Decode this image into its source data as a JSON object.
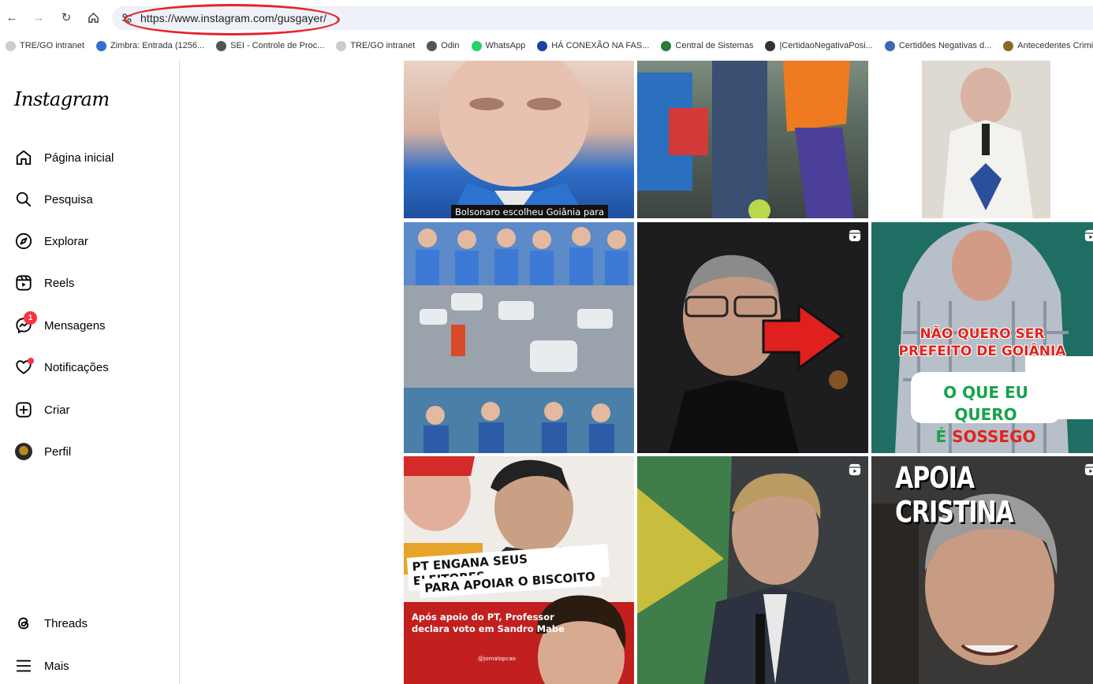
{
  "browser": {
    "url": "https://www.instagram.com/gusgayer/",
    "bookmarks": [
      {
        "label": "TRE/GO intranet",
        "icon": "tre-icon",
        "color": "#c9ccd1"
      },
      {
        "label": "Zimbra: Entrada (1256...",
        "icon": "zimbra-icon",
        "color": "#2f6fd1"
      },
      {
        "label": "SEI - Controle de Proc...",
        "icon": "globe-icon",
        "color": "#555555"
      },
      {
        "label": "TRE/GO intranet",
        "icon": "tre-icon",
        "color": "#c9ccd1"
      },
      {
        "label": "Odin",
        "icon": "globe-icon",
        "color": "#555555"
      },
      {
        "label": "WhatsApp",
        "icon": "whatsapp-icon",
        "color": "#25d366"
      },
      {
        "label": "HÁ CONEXÃO NA FAS...",
        "icon": "flag-icon",
        "color": "#2040a0"
      },
      {
        "label": "Central de Sistemas",
        "icon": "seal-icon",
        "color": "#2a7a3a"
      },
      {
        "label": "|CertidaoNegativaPosi...",
        "icon": "scales-icon",
        "color": "#333333"
      },
      {
        "label": "Certidões Negativas d...",
        "icon": "wing-icon",
        "color": "#3a6ab0"
      },
      {
        "label": "Antecedentes Crimina...",
        "icon": "police-icon",
        "color": "#8a6a20"
      }
    ]
  },
  "sidebar": {
    "logo": "Instagram",
    "items": [
      {
        "label": "Página inicial",
        "icon": "home-icon"
      },
      {
        "label": "Pesquisa",
        "icon": "search-icon"
      },
      {
        "label": "Explorar",
        "icon": "compass-icon"
      },
      {
        "label": "Reels",
        "icon": "reels-icon"
      },
      {
        "label": "Mensagens",
        "icon": "messenger-icon",
        "badge": "1"
      },
      {
        "label": "Notificações",
        "icon": "heart-icon"
      },
      {
        "label": "Criar",
        "icon": "plus-square-icon"
      },
      {
        "label": "Perfil",
        "icon": "avatar"
      }
    ],
    "bottom": [
      {
        "label": "Threads",
        "icon": "threads-icon"
      },
      {
        "label": "Mais",
        "icon": "menu-icon"
      }
    ]
  },
  "posts": {
    "p1_caption": "Bolsonaro escolheu Goiânia para",
    "p6_line1": "NÃO QUERO SER",
    "p6_line2": "PREFEITO DE GOIÂNIA",
    "p6_line3": "O QUE EU QUERO",
    "p6_line4a": "É ",
    "p6_line4b": "SOSSEGO",
    "p7_headline1": "PT ENGANA SEUS ELEITORES",
    "p7_headline2": "PARA APOIAR O BISCOITO",
    "p7_sub1": "Após apoio do PT, Professor",
    "p7_sub2": "declara voto em Sandro Mabe",
    "p7_handle": "@jornalopcao",
    "p9_caption": "APOIA CRISTINA"
  }
}
